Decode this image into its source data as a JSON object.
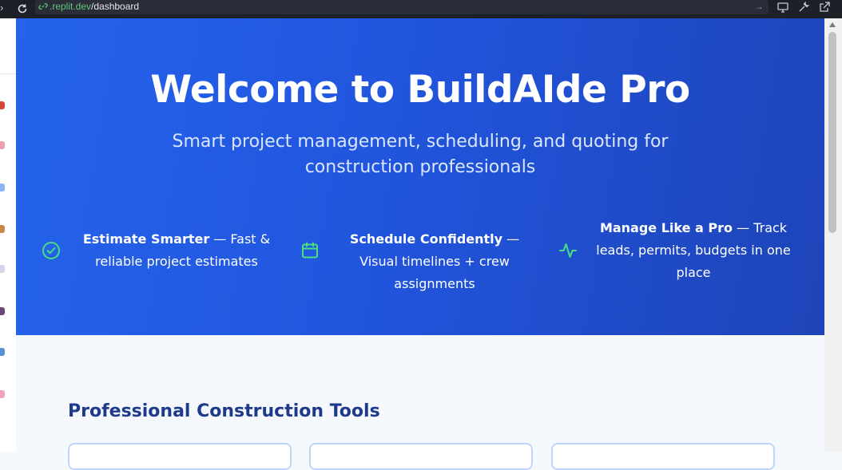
{
  "browser": {
    "url_host": ".replit.dev",
    "url_path": "/dashboard",
    "colors": {
      "bar": "#1e2028",
      "host": "#5fc77a"
    }
  },
  "hero": {
    "title": "Welcome to BuildAIde Pro",
    "subtitle": "Smart project management, scheduling, and quoting for construction professionals",
    "features": [
      {
        "icon": "check-circle-icon",
        "bold": "Estimate Smarter",
        "rest": " — Fast & reliable project estimates"
      },
      {
        "icon": "calendar-icon",
        "bold": "Schedule Confidently",
        "rest": " — Visual timelines + crew assignments"
      },
      {
        "icon": "activity-icon",
        "bold": "Manage Like a Pro",
        "rest": " — Track leads, permits, budgets in one place"
      }
    ],
    "colors": {
      "gradient_start": "#2563eb",
      "gradient_end": "#1e44b8",
      "feature_icon": "#4ade80"
    }
  },
  "tools": {
    "heading": "Professional Construction Tools",
    "heading_color": "#1e3a8a"
  }
}
